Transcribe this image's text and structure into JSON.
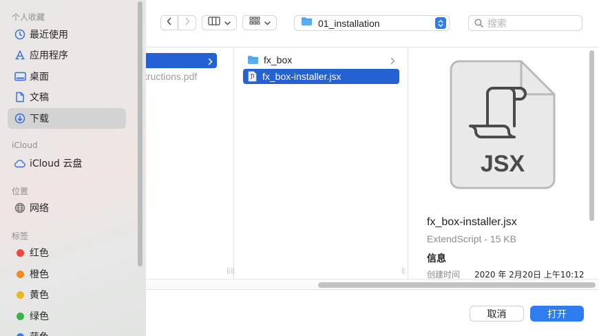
{
  "sidebar": {
    "sections": {
      "favorites": "个人收藏",
      "icloud": "iCloud",
      "locations": "位置",
      "tags": "标签"
    },
    "favorites": [
      {
        "label": "最近使用",
        "icon": "clock-icon"
      },
      {
        "label": "应用程序",
        "icon": "apps-icon"
      },
      {
        "label": "桌面",
        "icon": "desktop-icon"
      },
      {
        "label": "文稿",
        "icon": "document-icon"
      },
      {
        "label": "下载",
        "icon": "download-icon",
        "selected": true
      }
    ],
    "icloud_items": [
      {
        "label": "iCloud 云盘",
        "icon": "cloud-icon"
      }
    ],
    "location_items": [
      {
        "label": "网络",
        "icon": "globe-icon"
      }
    ],
    "tag_items": [
      {
        "label": "红色",
        "color": "#f0463c"
      },
      {
        "label": "橙色",
        "color": "#f08a24"
      },
      {
        "label": "黄色",
        "color": "#e8b81e"
      },
      {
        "label": "绿色",
        "color": "#37b34a"
      },
      {
        "label": "蓝色",
        "color": "#2f7bf0"
      }
    ]
  },
  "toolbar": {
    "path_label": "01_installation",
    "search_placeholder": "搜索"
  },
  "browser": {
    "col1": {
      "file_label": "tructions.pdf"
    },
    "col2": {
      "items": [
        {
          "label": "fx_box",
          "type": "folder",
          "has_children": true
        },
        {
          "label": "fx_box-installer.jsx",
          "type": "jsx",
          "selected": true
        }
      ]
    },
    "preview": {
      "icon_text": "JSX",
      "name": "fx_box-installer.jsx",
      "kind": "ExtendScript - 15 KB",
      "info_label": "信息",
      "created_key": "创建时间",
      "created_value": "2020 年 2月20日 上午10:12"
    }
  },
  "footer": {
    "cancel_label": "取消",
    "open_label": "打开"
  },
  "colors": {
    "accent": "#2462d3",
    "open_button": "#2f7bf0",
    "folder": "#5aaef0"
  }
}
